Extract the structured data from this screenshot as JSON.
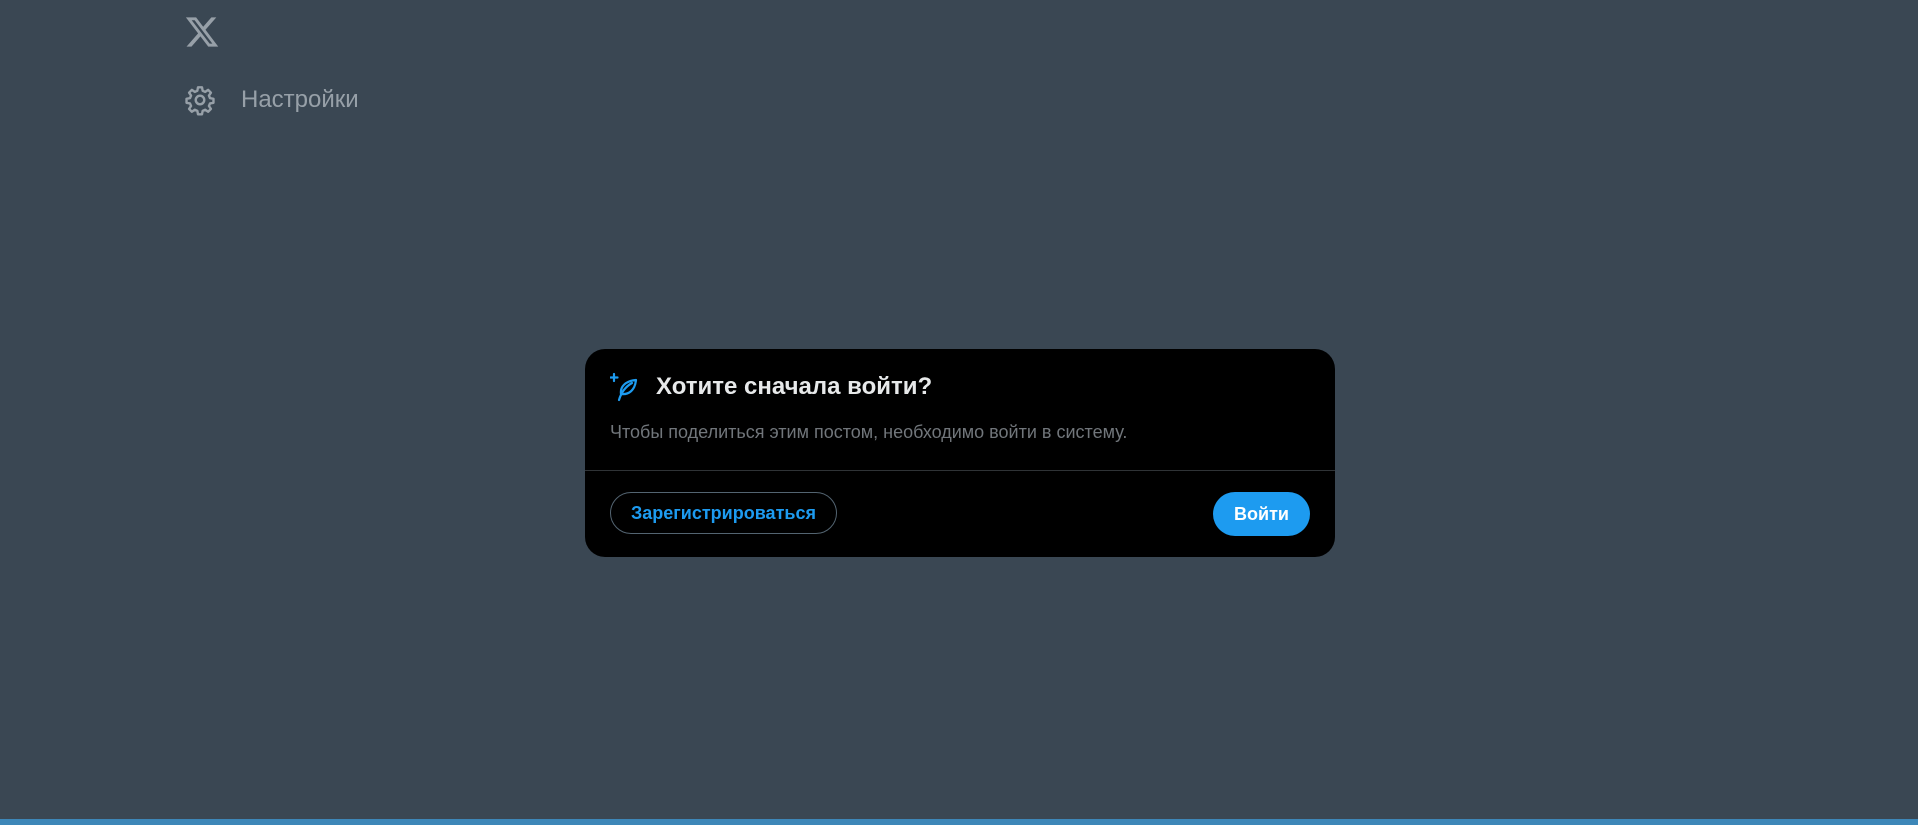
{
  "logo": {
    "icon": "x-logo-icon"
  },
  "nav": {
    "settings_label": "Настройки",
    "settings_icon": "gear-icon"
  },
  "modal": {
    "icon": "feather-sparkle-icon",
    "title": "Хотите сначала войти?",
    "description": "Чтобы поделиться этим постом, необходимо войти в систему.",
    "signup_label": "Зарегистрироваться",
    "login_label": "Войти"
  },
  "colors": {
    "background": "#3a4753",
    "modal_background": "#000000",
    "accent": "#1d9bf0",
    "bottom_bar": "#3d87b8"
  }
}
